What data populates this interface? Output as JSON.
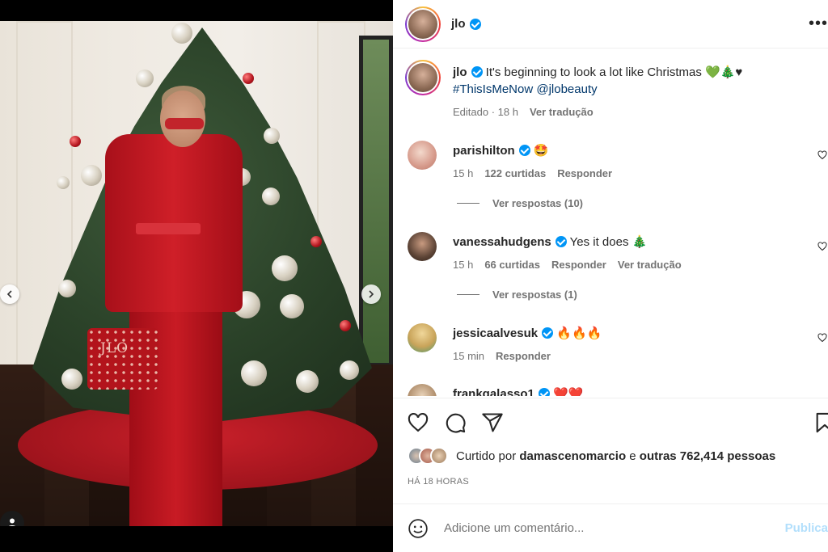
{
  "post": {
    "username": "jlo",
    "verified": true
  },
  "carousel": {
    "prev_icon": "chevron-left-icon",
    "next_icon": "chevron-right-icon",
    "dot_count": 4,
    "active_dot": 2,
    "bag_monogram": "JLO"
  },
  "caption": {
    "username": "jlo",
    "text": "It's beginning to look a lot like Christmas 💚🎄♥",
    "hashtags": "#ThisIsMeNow @jlobeauty",
    "edited": "Editado · 18 h",
    "translate": "Ver tradução"
  },
  "comments": [
    {
      "username": "parishilton",
      "text": "🤩",
      "time": "15 h",
      "likes": "122 curtidas",
      "reply": "Responder",
      "translate": "",
      "view_replies": "Ver respostas (10)"
    },
    {
      "username": "vanessahudgens",
      "text": "Yes it does 🎄",
      "time": "15 h",
      "likes": "66 curtidas",
      "reply": "Responder",
      "translate": "Ver tradução",
      "view_replies": "Ver respostas (1)"
    },
    {
      "username": "jessicaalvesuk",
      "text": "🔥🔥🔥",
      "time": "15 min",
      "likes": "",
      "reply": "Responder",
      "translate": "",
      "view_replies": ""
    },
    {
      "username": "frankgalasso1",
      "text": "❤️❤️",
      "time": "",
      "likes": "",
      "reply": "",
      "translate": "",
      "view_replies": ""
    }
  ],
  "actions": {
    "like_icon": "heart-icon",
    "comment_icon": "comment-icon",
    "share_icon": "send-icon",
    "save_icon": "bookmark-icon"
  },
  "likes": {
    "prefix": "Curtido por",
    "user": "damascenomarcio",
    "middle": "e",
    "others": "outras 762,414 pessoas"
  },
  "timestamp": "HÁ 18 HORAS",
  "composer": {
    "placeholder": "Adicione um comentário...",
    "publish": "Publica",
    "emoji_icon": "smiley-icon"
  },
  "colors": {
    "link": "#00376b",
    "verified": "#0095f6",
    "publish_disabled": "#b2dffc"
  }
}
